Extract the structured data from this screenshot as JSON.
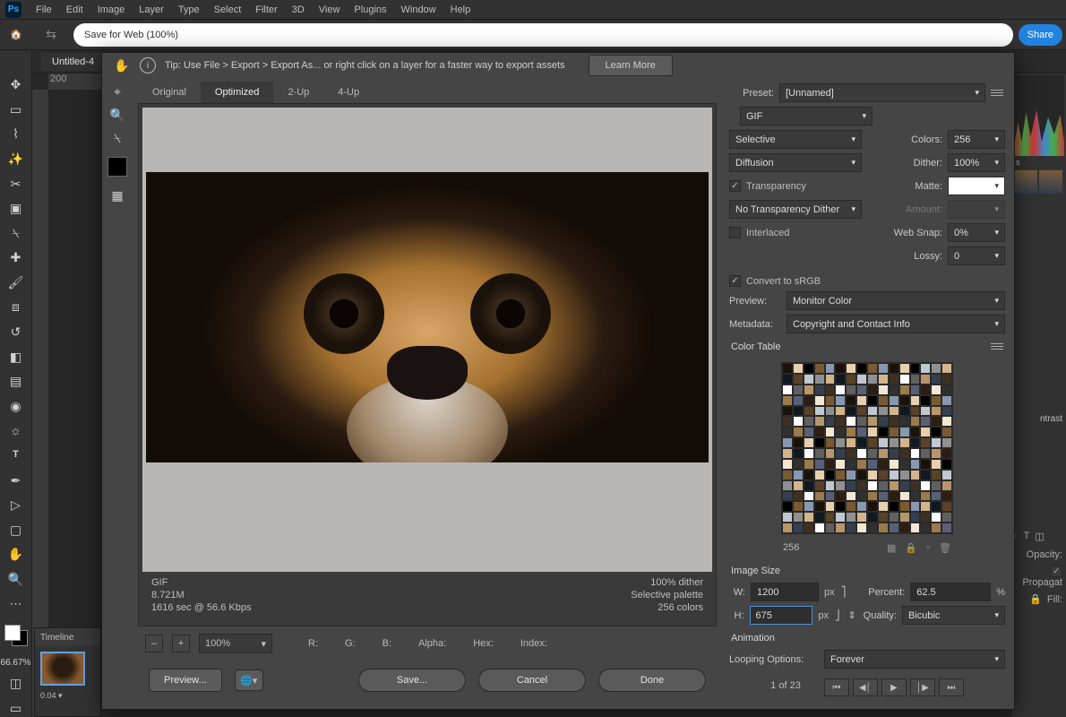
{
  "menubar": [
    "File",
    "Edit",
    "Image",
    "Layer",
    "Type",
    "Select",
    "Filter",
    "3D",
    "View",
    "Plugins",
    "Window",
    "Help"
  ],
  "titlebar": {
    "search_text": "Save for Web (100%)",
    "share": "Share"
  },
  "doc_tab": "Untitled-4",
  "zoom_label": "66.67%",
  "timeline": {
    "title": "Timeline",
    "frame_time": "0.04 ▾"
  },
  "ruler_marks": [
    "200"
  ],
  "right_panels": {
    "bc": "ntrast",
    "opacity": "Opacity:",
    "propagate": "Propagat",
    "fill": "Fill:"
  },
  "sfw": {
    "tip": "Tip: Use File > Export > Export As...  or right click on a layer for a faster way to export assets",
    "learn_more": "Learn More",
    "tabs": [
      "Original",
      "Optimized",
      "2-Up",
      "4-Up"
    ],
    "active_tab": 1,
    "meta_left": {
      "fmt": "GIF",
      "size": "8.721M",
      "time": "1616 sec @ 56.6 Kbps"
    },
    "meta_right": {
      "dither": "100% dither",
      "palette": "Selective palette",
      "colors": "256 colors"
    },
    "zoom_controls": {
      "value": "100%",
      "r": "R:",
      "g": "G:",
      "b": "B:",
      "alpha": "Alpha:",
      "hex": "Hex:",
      "index": "Index:"
    },
    "preview_btn": "Preview...",
    "save_btn": "Save...",
    "cancel_btn": "Cancel",
    "done_btn": "Done",
    "settings": {
      "preset_lbl": "Preset:",
      "preset": "[Unnamed]",
      "format": "GIF",
      "reduction": "Selective",
      "colors_lbl": "Colors:",
      "colors": "256",
      "dither_method": "Diffusion",
      "dither_lbl": "Dither:",
      "dither": "100%",
      "transparency_lbl": "Transparency",
      "transparency_on": true,
      "matte_lbl": "Matte:",
      "transp_dither": "No Transparency Dither",
      "amount_lbl": "Amount:",
      "interlaced_lbl": "Interlaced",
      "interlaced_on": false,
      "websnap_lbl": "Web Snap:",
      "websnap": "0%",
      "lossy_lbl": "Lossy:",
      "lossy": "0",
      "srgb_lbl": "Convert to sRGB",
      "srgb_on": true,
      "preview_lbl": "Preview:",
      "preview": "Monitor Color",
      "metadata_lbl": "Metadata:",
      "metadata": "Copyright and Contact Info",
      "colortable_title": "Color Table",
      "colortable_count": "256",
      "imagesize_title": "Image Size",
      "w_lbl": "W:",
      "w": "1200",
      "w_unit": "px",
      "h_lbl": "H:",
      "h": "675",
      "h_unit": "px",
      "percent_lbl": "Percent:",
      "percent": "62.5",
      "percent_unit": "%",
      "quality_lbl": "Quality:",
      "quality": "Bicubic",
      "animation_title": "Animation",
      "loop_lbl": "Looping Options:",
      "loop": "Forever",
      "frame_counter": "1 of 23"
    }
  }
}
